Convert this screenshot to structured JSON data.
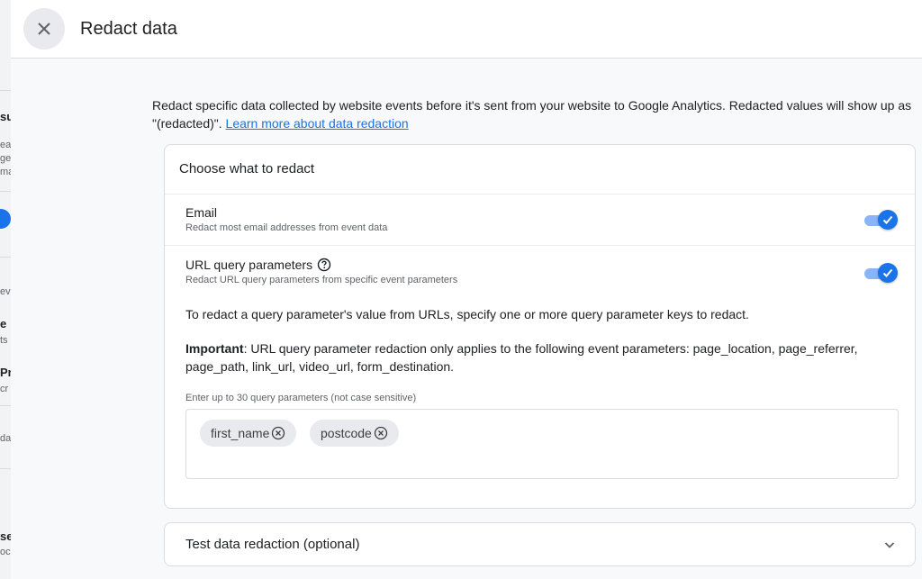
{
  "background": {
    "fragments": [
      "su",
      "ea",
      "ge",
      "ma",
      "ev",
      "e",
      "ts",
      "Pr",
      "cr",
      "da",
      "se",
      "oc"
    ]
  },
  "dialog": {
    "title": "Redact data",
    "close_icon": "close-icon",
    "intro_text": "Redact specific data collected by website events before it's sent from your website to Google Analytics. Redacted values will show up as \"(redacted)\". ",
    "intro_link": "Learn more about data redaction",
    "section": {
      "title": "Choose what to redact",
      "options": [
        {
          "title": "Email",
          "subtitle": "Redact most email addresses from event data",
          "enabled": true
        },
        {
          "title": "URL query parameters",
          "subtitle": "Redact URL query parameters from specific event parameters",
          "enabled": true,
          "help_icon": "help-circle-icon"
        }
      ],
      "instruction": "To redact a query parameter's value from URLs, specify one or more query parameter keys to redact.",
      "important_label": "Important",
      "important_text": ": URL query parameter redaction only applies to the following event parameters: page_location, page_referrer, page_path, link_url, video_url, form_destination.",
      "field_label": "Enter up to 30 query parameters (not case sensitive)",
      "chips": [
        "first_name",
        "postcode"
      ]
    },
    "test_section": {
      "title": "Test data redaction (optional)",
      "expand_icon": "chevron-down-icon"
    }
  },
  "colors": {
    "accent": "#1a73e8",
    "toggle_track": "#8ab4f8",
    "link": "#1a73e8"
  }
}
